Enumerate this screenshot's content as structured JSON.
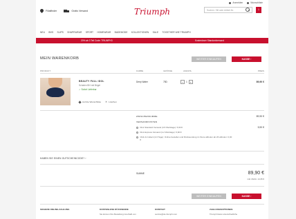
{
  "header": {
    "store_finder": "Filialfinder",
    "shipping": "Gratis Versand ",
    "login": "Anmelden",
    "wishlist": "Wunschliste",
    "logo": "Triumph",
    "search_placeholder": "Suchen: Stil oder Artikel-Nr.",
    "cart_count": "1"
  },
  "nav": [
    "Neu",
    "BHs",
    "Slips",
    "Shapewear",
    "Sport",
    "Homewear",
    "Bademode",
    "Kollektionen",
    "Sale",
    "Together wie Triumph"
  ],
  "promo": {
    "left": "20% ab 3 Teil Code: TRIUMPH3",
    "right": "Kostenloser Standardversand"
  },
  "cart": {
    "title": "MEIN WARENKORB",
    "continue_label": "WEITER EINKAUFEN",
    "checkout_label": "KASSE  ›"
  },
  "table": {
    "headers": [
      "PRODUKT",
      "FARBE",
      "GRÖSSE",
      "ANZAHL",
      "PREIS"
    ]
  },
  "item": {
    "name": "BEAUTY FULL IDOL",
    "subtitle": "Schalen BH mit Bügel",
    "stock": "✓ Sofort Lieferbar",
    "color": "Deep Water",
    "size": "75D",
    "qty": "1",
    "price": "89,90 €",
    "wishlist": "Auf die Wunschliste",
    "remove": "Löschen"
  },
  "summary": {
    "subtotal_label": "ZWISCHENSUMME",
    "subtotal_value": "89,90 €",
    "shipping_label": "VERSANDKOSTEN",
    "shipping_value": "5,90 €",
    "options": [
      {
        "text": "DHL Standard Versand (3-5 Werktage): 5,90 €",
        "selected": true
      },
      {
        "text": "DHL Express Versand (1-2 Werktage): 6,90 €",
        "selected": false
      },
      {
        "text": "Click & Collect (4-6 Tage): Online bestellen und Rücksendung im Store abholen ab 26 abholen: 0,00 €",
        "selected": false
      }
    ],
    "voucher": "HABEN SIE EINEN GUTSCHEINCODE?  ›",
    "total_label": "SUMME",
    "total_value": "89,90 €",
    "vat": "inkl. MwSt. 14,35 €"
  },
  "footer": {
    "cols": [
      "SICHERE ONLINE-ZAHLUNG",
      "KOSTENLOSE RÜCKSENDE",
      "KONTAKT",
      "ZAHLUNGSOPTIONEN"
    ],
    "subs": [
      "Sie können Ihre Bestellung innerhalb von",
      "service@de.triumph.com",
      "Triumph bietet unterschiedliche"
    ]
  }
}
